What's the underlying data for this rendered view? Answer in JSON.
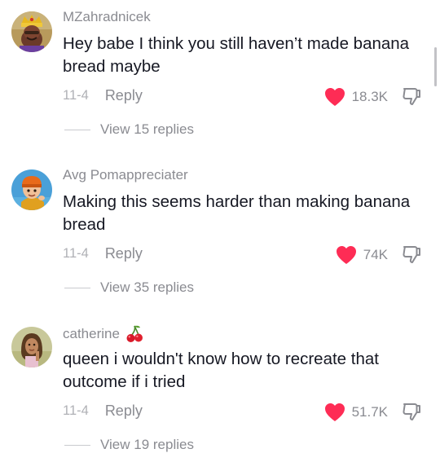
{
  "comments": [
    {
      "username": "MZahradnicek",
      "text": "Hey babe I think you still haven’t made banana bread maybe",
      "date": "11-4",
      "reply_label": "Reply",
      "likes": "18.3K",
      "view_replies": "View 15 replies"
    },
    {
      "username": "Avg Pomappreciater",
      "text": "Making this seems harder than making banana bread",
      "date": "11-4",
      "reply_label": "Reply",
      "likes": "74K",
      "view_replies": "View 35 replies"
    },
    {
      "username": "catherine",
      "username_emoji": "cherries-icon",
      "text": "queen i wouldn't know how to recreate that outcome if i tried",
      "date": "11-4",
      "reply_label": "Reply",
      "likes": "51.7K",
      "view_replies": "View 19 replies"
    }
  ],
  "colors": {
    "like_heart": "#fe2c55",
    "secondary_text": "#8a8b91",
    "primary_text": "#161823"
  }
}
